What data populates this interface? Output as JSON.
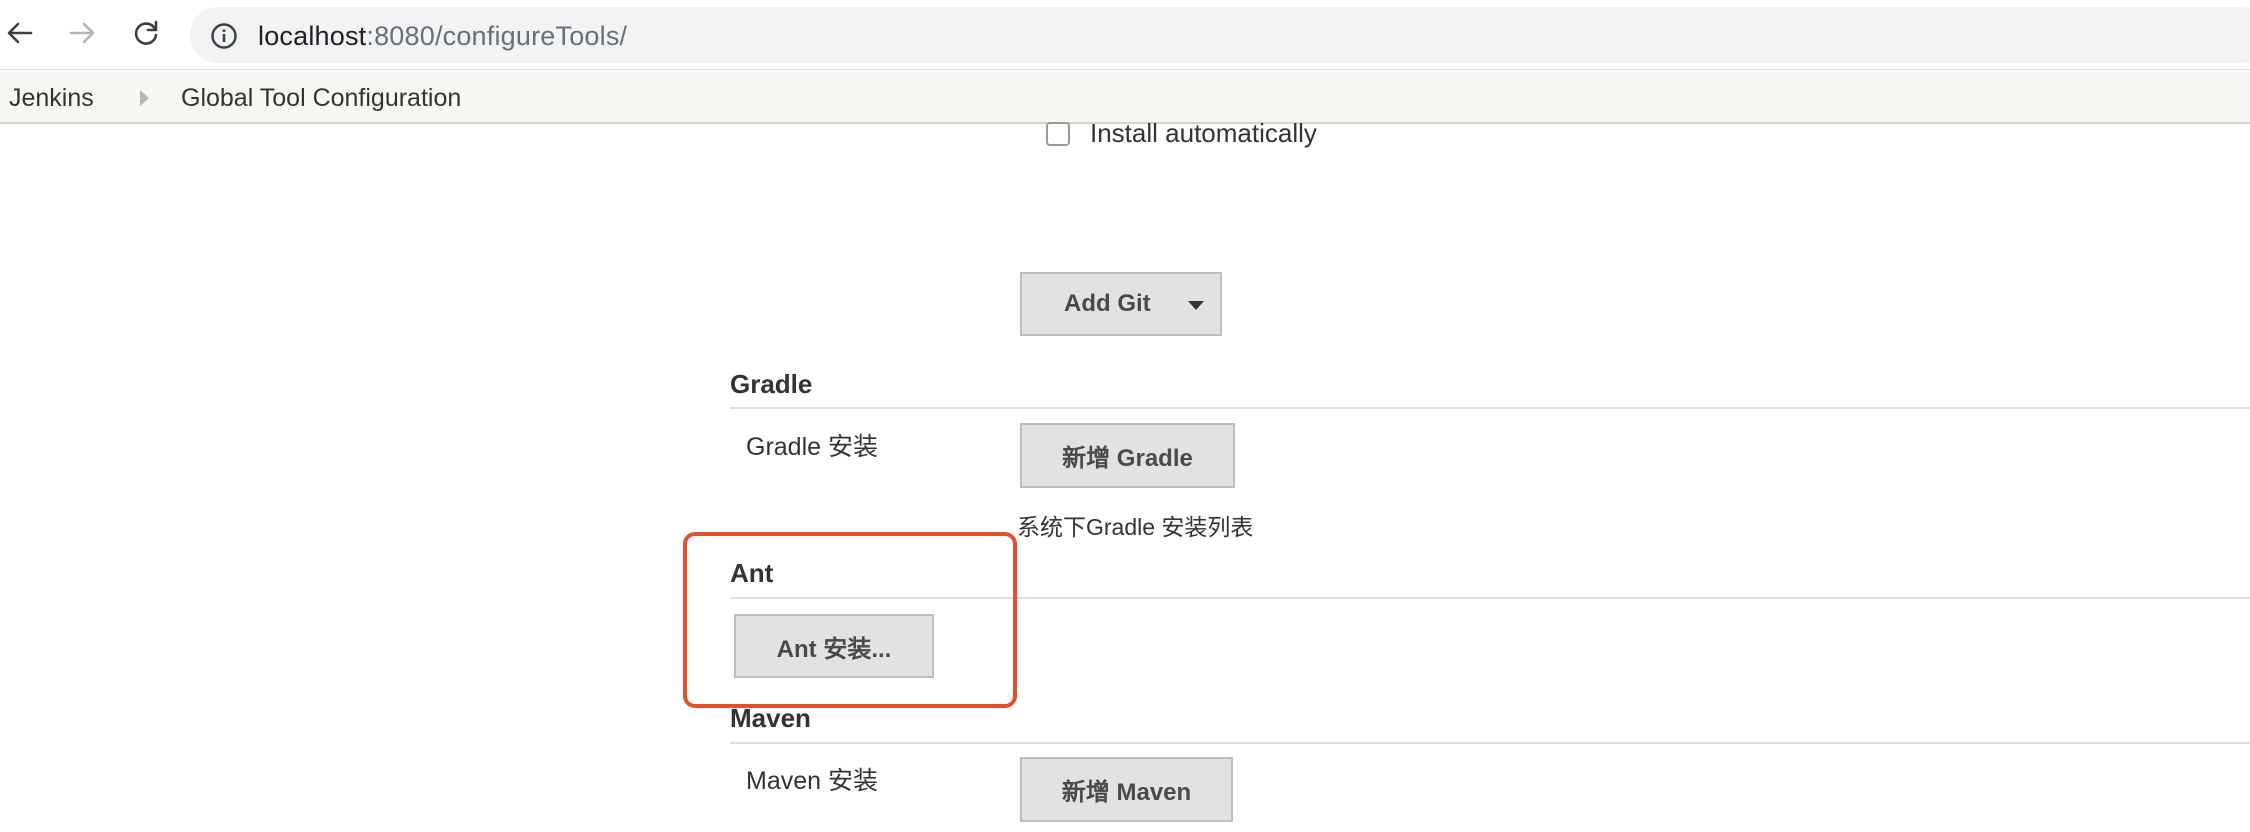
{
  "browser": {
    "url_host": "localhost",
    "url_path": ":8080/configureTools/",
    "icons": {
      "back": "arrow-left-icon",
      "forward": "arrow-right-icon",
      "reload": "reload-icon",
      "site_info": "info-icon"
    }
  },
  "breadcrumb": {
    "items": [
      "Jenkins",
      "Global Tool Configuration"
    ]
  },
  "git": {
    "install_automatically_label": "Install automatically",
    "install_automatically_checked": false,
    "add_button_label": "Add Git"
  },
  "gradle": {
    "title": "Gradle",
    "field_label": "Gradle 安装",
    "add_button_label": "新增 Gradle",
    "help_text": "系统下Gradle 安装列表"
  },
  "ant": {
    "title": "Ant",
    "install_button_label": "Ant 安装..."
  },
  "maven": {
    "title": "Maven",
    "field_label": "Maven 安装",
    "add_button_label": "新增 Maven"
  },
  "colors": {
    "highlight_border": "#e4512f",
    "breadcrumb_bg": "#f6f9f3",
    "button_bg": "#e2e2e2"
  }
}
